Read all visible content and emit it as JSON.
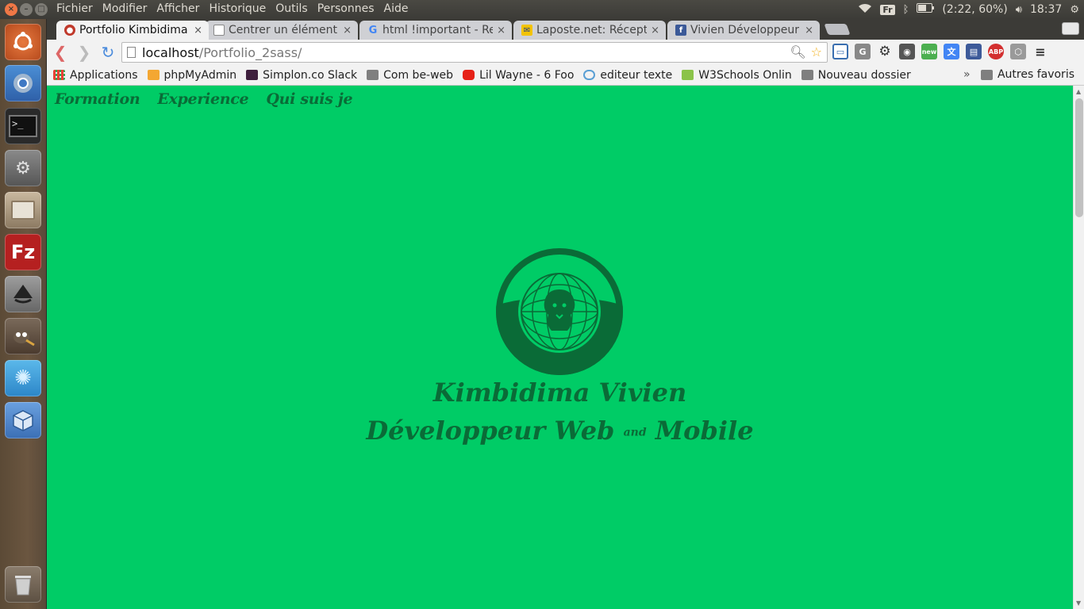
{
  "top_panel": {
    "menu": [
      "Fichier",
      "Modifier",
      "Afficher",
      "Historique",
      "Outils",
      "Personnes",
      "Aide"
    ],
    "keyboard_layout": "Fr",
    "battery": "(2:22, 60%)",
    "clock": "18:37"
  },
  "browser": {
    "tabs": [
      {
        "title": "Portfolio Kimbidima",
        "favicon": "portfolio-icon",
        "color": "#c0392b"
      },
      {
        "title": "Centrer un élément",
        "favicon": "page-icon",
        "color": "#888888"
      },
      {
        "title": "html !important - Re",
        "favicon": "google-icon",
        "color": "#4285f4"
      },
      {
        "title": "Laposte.net: Récept",
        "favicon": "laposte-icon",
        "color": "#f3c300"
      },
      {
        "title": "Vivien Développeur",
        "favicon": "facebook-icon",
        "color": "#3b5998"
      }
    ],
    "url": {
      "host": "localhost",
      "path": "/Portfolio_2sass/"
    },
    "bookmarks": [
      {
        "label": "Applications",
        "icon": "apps-grid-icon"
      },
      {
        "label": "phpMyAdmin",
        "icon": "phpmyadmin-icon"
      },
      {
        "label": "Simplon.co Slack",
        "icon": "slack-icon"
      },
      {
        "label": "Com be-web",
        "icon": "folder-icon"
      },
      {
        "label": "Lil Wayne - 6 Foo",
        "icon": "youtube-icon"
      },
      {
        "label": "editeur texte",
        "icon": "cloud-icon"
      },
      {
        "label": "W3Schools Onlin",
        "icon": "w3schools-icon"
      },
      {
        "label": "Nouveau dossier",
        "icon": "folder-icon"
      }
    ],
    "other_bookmarks": "Autres favoris",
    "chevron": "»"
  },
  "page": {
    "nav": [
      "Formation",
      "Experience",
      "Qui suis je"
    ],
    "name": "Kimbidima Vivien",
    "role_before": "Développeur Web",
    "role_amp": "and",
    "role_after": "Mobile",
    "colors": {
      "background": "#00cc66",
      "text": "#0a6b37",
      "logo": "#0a6b37"
    }
  }
}
